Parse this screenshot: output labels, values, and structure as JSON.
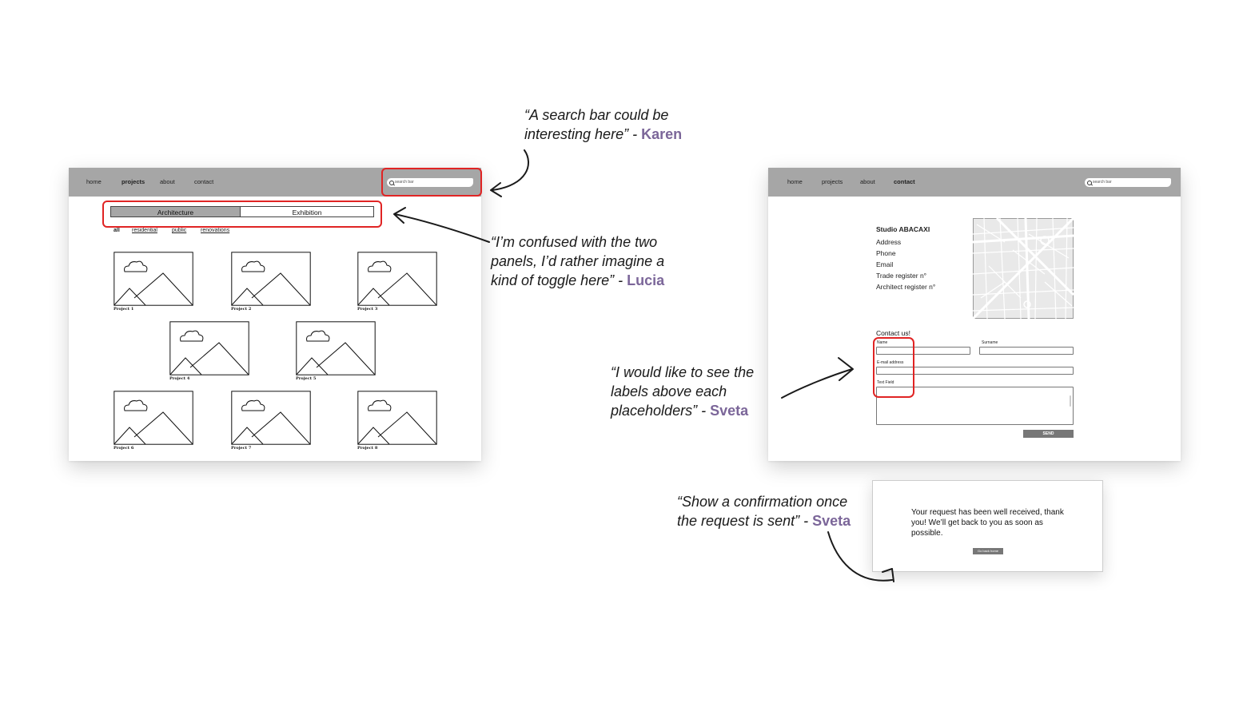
{
  "annotations": {
    "karen": {
      "quote": "“A search bar could be interesting here” - ",
      "author": "Karen"
    },
    "lucia": {
      "quote": "“I’m confused with the two panels, I’d rather imagine a kind of toggle here” - ",
      "author": "Lucia"
    },
    "sveta_labels": {
      "quote": "“I would like to see the labels above each placeholders” - ",
      "author": "Sveta"
    },
    "sveta_confirm": {
      "quote": "“Show a confirmation once the request is sent” - ",
      "author": "Sveta"
    }
  },
  "projects_page": {
    "nav": {
      "home": "home",
      "projects": "projects",
      "about": "about",
      "contact": "contact"
    },
    "search_placeholder": "search bar",
    "tabs": {
      "architecture": "Architecture",
      "exhibition": "Exhibition"
    },
    "filters": {
      "all": "all",
      "residential": "residential",
      "public": "public",
      "renovations": "renovations"
    },
    "projects": [
      "Project 1",
      "Project 2",
      "Project 3",
      "Project 4",
      "Project 5",
      "Project 6",
      "Project 7",
      "Project 8"
    ]
  },
  "contact_page": {
    "nav": {
      "home": "home",
      "projects": "projects",
      "about": "about",
      "contact": "contact"
    },
    "search_placeholder": "search bar",
    "studio_name": "Studio ABACAXI",
    "info": [
      "Address",
      "Phone",
      "Email",
      "Trade register n°",
      "Architect register n°"
    ],
    "form_title": "Contact us!",
    "labels": {
      "name": "Name",
      "surname": "Surname",
      "email": "E-mail address",
      "text": "Text Field"
    },
    "send_label": "SEND"
  },
  "confirmation": {
    "message": "Your request has been well received, thank you! We’ll get back to you as soon as possible.",
    "button": "Go back home"
  },
  "colors": {
    "navbar": "#a6a6a6",
    "highlight": "#e02424",
    "author": "#7b6699",
    "send_button": "#777777"
  }
}
